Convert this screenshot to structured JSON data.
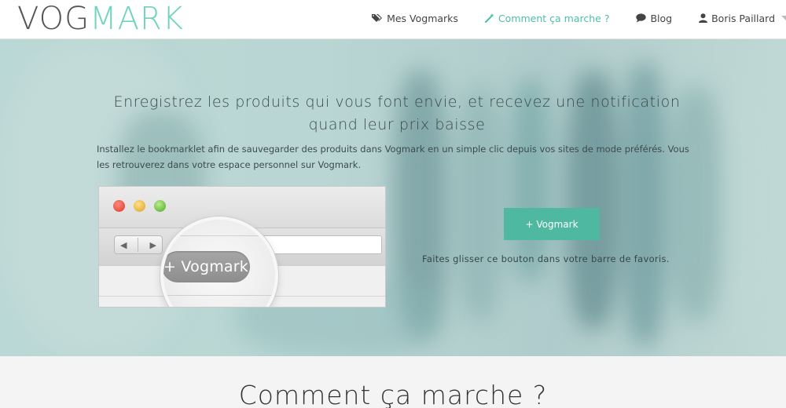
{
  "header": {
    "logo": {
      "part1": "VOG",
      "part2": "MARK"
    },
    "nav": [
      {
        "label": "Mes Vogmarks",
        "icon": "tags-icon",
        "active": false
      },
      {
        "label": "Comment ça marche ?",
        "icon": "magic-wand-icon",
        "active": true
      },
      {
        "label": "Blog",
        "icon": "speech-bubble-icon",
        "active": false
      },
      {
        "label": "Boris Paillard",
        "icon": "user-icon",
        "active": false
      }
    ]
  },
  "hero": {
    "title_line1": "Enregistrez les produits qui vous font envie, et recevez une notification",
    "title_line2": "quand leur prix baisse",
    "description": "Installez le bookmarklet afin de sauvegarder des produits dans Vogmark en un simple clic depuis vos sites de mode préférés. Vous les retrouverez dans votre espace personnel sur Vogmark.",
    "illustration_button_label": "+ Vogmark",
    "cta_label": "+ Vogmark",
    "cta_hint": "Faites glisser ce bouton dans votre barre de favoris."
  },
  "section": {
    "title": "Comment ça marche ?"
  },
  "colors": {
    "accent": "#4fb8a0",
    "active_nav": "#4cbfa6",
    "logo_mark": "#6fd3c0"
  }
}
